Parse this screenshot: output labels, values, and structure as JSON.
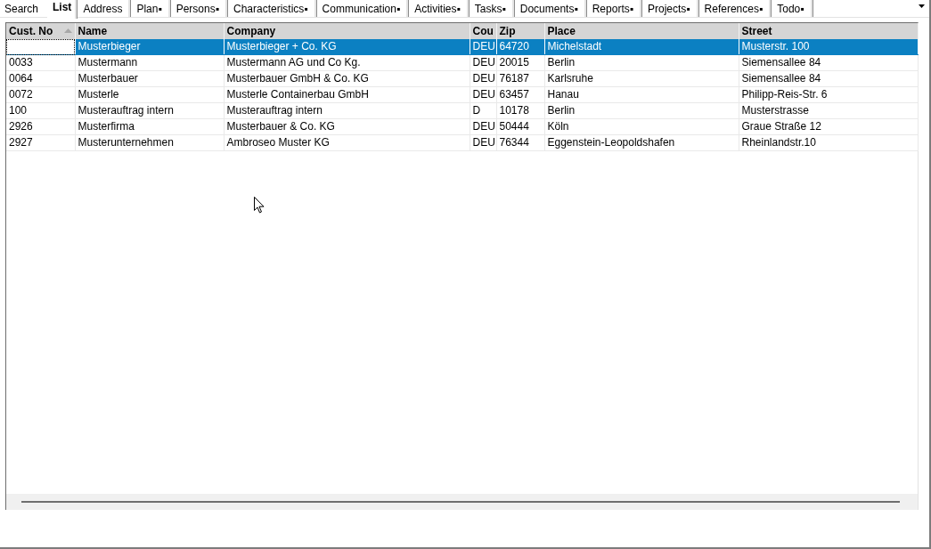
{
  "tabs": [
    {
      "label": "Search",
      "selected": false
    },
    {
      "label": "List",
      "selected": true
    },
    {
      "label": "Address",
      "selected": false
    },
    {
      "label": "Plan▪",
      "selected": false
    },
    {
      "label": "Persons▪",
      "selected": false
    },
    {
      "label": "Characteristics▪",
      "selected": false
    },
    {
      "label": "Communication▪",
      "selected": false
    },
    {
      "label": "Activities▪",
      "selected": false
    },
    {
      "label": "Tasks▪",
      "selected": false
    },
    {
      "label": "Documents▪",
      "selected": false
    },
    {
      "label": "Reports▪",
      "selected": false
    },
    {
      "label": "Projects▪",
      "selected": false
    },
    {
      "label": "References▪",
      "selected": false
    },
    {
      "label": "Todo▪",
      "selected": false
    }
  ],
  "table": {
    "columns": [
      {
        "label": "Cust. No",
        "sorted": true
      },
      {
        "label": "Name",
        "sorted": false
      },
      {
        "label": "Company",
        "sorted": false
      },
      {
        "label": "Cou",
        "sorted": false
      },
      {
        "label": "Zip",
        "sorted": false
      },
      {
        "label": "Place",
        "sorted": false
      },
      {
        "label": "Street",
        "sorted": false
      }
    ],
    "rows": [
      {
        "selected": true,
        "focused": true,
        "name": "Musterbieger",
        "company": "Musterbieger + Co. KG",
        "column_4": "DEU",
        "zip": "64720",
        "place": "Michelstadt",
        "street": "Musterstr. 100"
      },
      {
        "selected": false,
        "focused": false,
        "cust_no": "0033",
        "name": "Mustermann",
        "company": "Mustermann AG und Co Kg.",
        "column_4": "DEU",
        "zip": "20015",
        "place": "Berlin",
        "street": "Siemensallee 84"
      },
      {
        "selected": false,
        "focused": false,
        "cust_no": "0064",
        "name": "Musterbauer",
        "company": "Musterbauer GmbH & Co. KG",
        "column_4": "DEU",
        "zip": "76187",
        "place": "Karlsruhe",
        "street": "Siemensallee 84"
      },
      {
        "selected": false,
        "focused": false,
        "cust_no": "0072",
        "name": "Musterle",
        "company": "Musterle Containerbau GmbH",
        "column_4": "DEU",
        "zip": "63457",
        "place": "Hanau",
        "street": "Philipp-Reis-Str. 6"
      },
      {
        "selected": false,
        "focused": false,
        "cust_no": "100",
        "name": "Musterauftrag intern",
        "company": "Musterauftrag intern",
        "column_4": "D",
        "zip": "10178",
        "place": "Berlin",
        "street": "Musterstrasse"
      },
      {
        "selected": false,
        "focused": false,
        "cust_no": "2926",
        "name": "Musterfirma",
        "company": "Musterbauer & Co. KG",
        "column_4": "DEU",
        "zip": "50444",
        "place": "Köln",
        "street": "Graue Straße 12"
      },
      {
        "selected": false,
        "focused": false,
        "cust_no": "2927",
        "name": "Musterunternehmen",
        "company": "Ambroseo Muster KG",
        "column_4": "DEU",
        "zip": "76344",
        "place": "Eggenstein-Leopoldshafen",
        "street": "Rheinlandstr.10"
      }
    ]
  }
}
